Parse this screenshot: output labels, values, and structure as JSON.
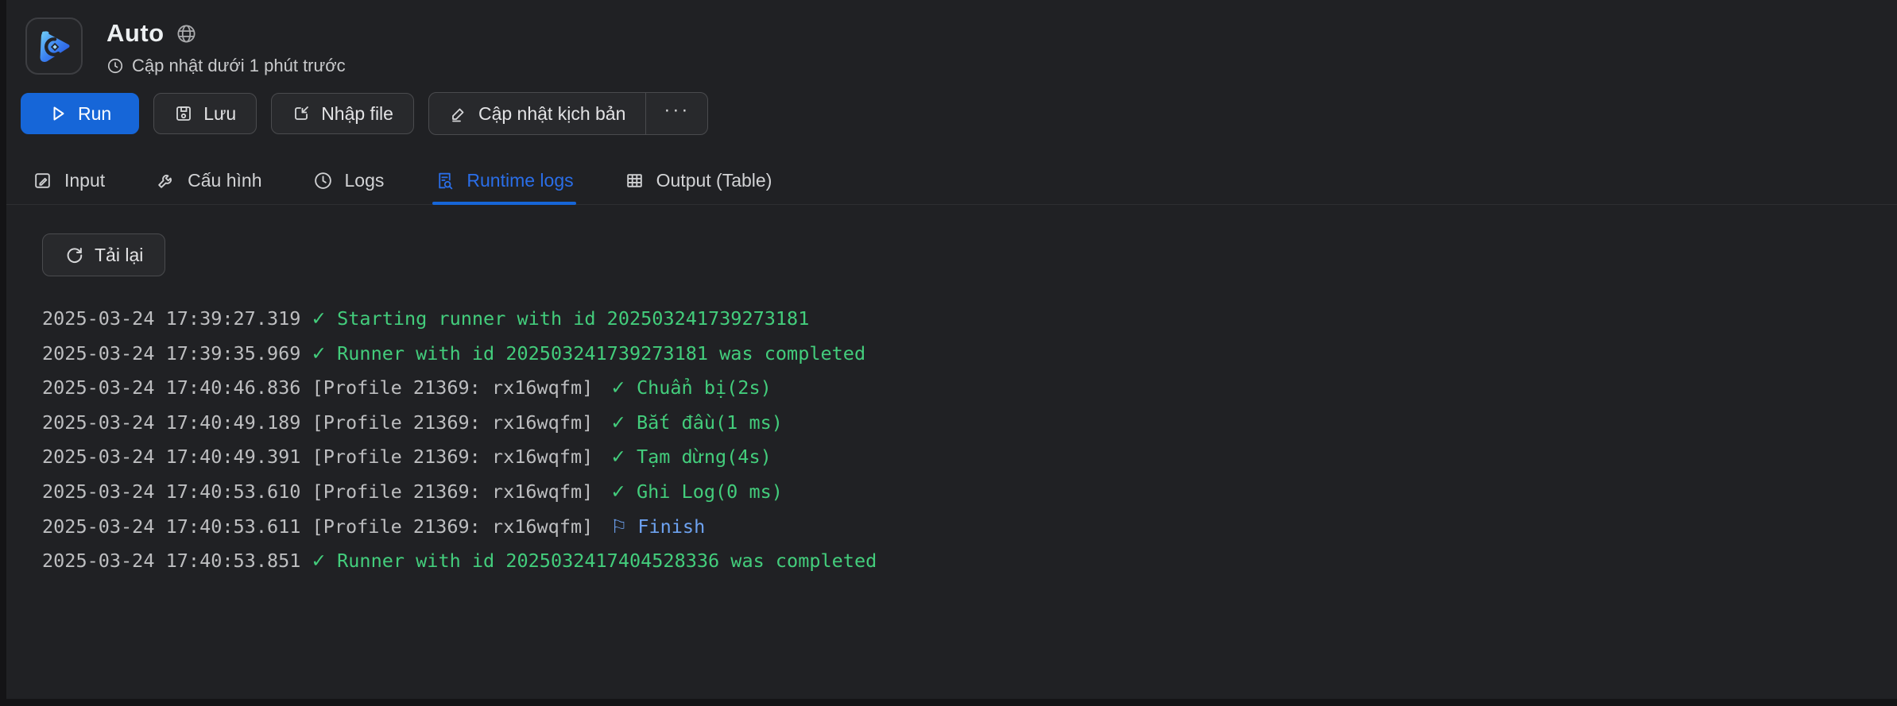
{
  "header": {
    "app_title": "Auto",
    "updated_text": "Cập nhật dưới 1 phút trước"
  },
  "toolbar": {
    "run": "Run",
    "save": "Lưu",
    "import_file": "Nhập file",
    "update_script": "Cập nhật kịch bản",
    "more": "···"
  },
  "tabs": [
    {
      "label": "Input",
      "icon": "edit-box-icon",
      "active": false
    },
    {
      "label": "Cấu hình",
      "icon": "wrench-icon",
      "active": false
    },
    {
      "label": "Logs",
      "icon": "clock-icon",
      "active": false
    },
    {
      "label": "Runtime logs",
      "icon": "document-search-icon",
      "active": true
    },
    {
      "label": "Output (Table)",
      "icon": "table-icon",
      "active": false
    }
  ],
  "runtime_logs": {
    "reload": "Tải lại",
    "icon_glyphs": {
      "check": "✓",
      "flag": "⚐"
    },
    "lines": [
      {
        "timestamp": "2025-03-24 17:39:27.319",
        "profile": "",
        "icon": "check",
        "message": "Starting runner with id 202503241739273181",
        "style": "success"
      },
      {
        "timestamp": "2025-03-24 17:39:35.969",
        "profile": "",
        "icon": "check",
        "message": "Runner with id 202503241739273181 was completed",
        "style": "success"
      },
      {
        "timestamp": "2025-03-24 17:40:46.836",
        "profile": "[Profile 21369: rx16wqfm]",
        "icon": "check",
        "message": "Chuẩn bị(2s)",
        "style": "success"
      },
      {
        "timestamp": "2025-03-24 17:40:49.189",
        "profile": "[Profile 21369: rx16wqfm]",
        "icon": "check",
        "message": "Bắt đầu(1 ms)",
        "style": "success"
      },
      {
        "timestamp": "2025-03-24 17:40:49.391",
        "profile": "[Profile 21369: rx16wqfm]",
        "icon": "check",
        "message": "Tạm dừng(4s)",
        "style": "success"
      },
      {
        "timestamp": "2025-03-24 17:40:53.610",
        "profile": "[Profile 21369: rx16wqfm]",
        "icon": "check",
        "message": "Ghi Log(0 ms)",
        "style": "success"
      },
      {
        "timestamp": "2025-03-24 17:40:53.611",
        "profile": "[Profile 21369: rx16wqfm]",
        "icon": "flag",
        "message": "Finish",
        "style": "finish"
      },
      {
        "timestamp": "2025-03-24 17:40:53.851",
        "profile": "",
        "icon": "check",
        "message": "Runner with id 2025032417404528336 was completed",
        "style": "success"
      }
    ]
  },
  "colors": {
    "background": "#202124",
    "accent_blue": "#1666d8",
    "tab_active_blue": "#2a6ee8",
    "log_green": "#43cd7c",
    "finish_blue": "#6da2f0",
    "timestamp_gray": "#bdbec0"
  }
}
